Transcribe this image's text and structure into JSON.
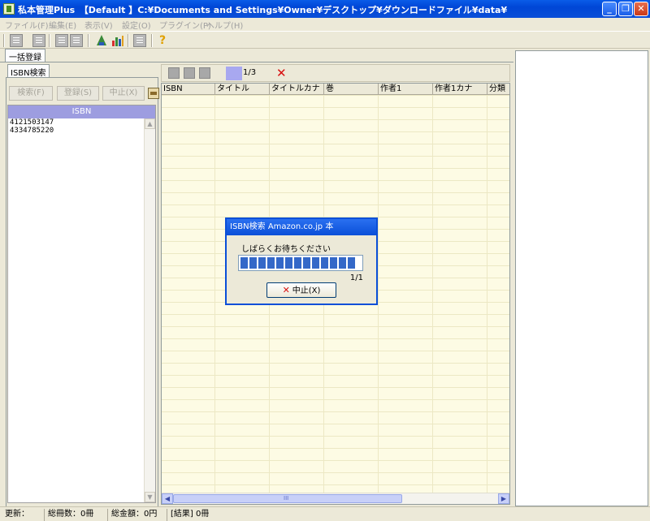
{
  "titlebar": {
    "app_title": "私本管理Plus　【Default 】C:¥Documents and Settings¥Owner¥デスクトップ¥ダウンロードファイル¥data¥",
    "minimize": "_",
    "restore": "❐",
    "close": "✕"
  },
  "menu": {
    "file": "ファイル(F)",
    "edit": "編集(E)",
    "view": "表示(V)",
    "settings": "設定(O)",
    "plugin": "プラグイン(P)",
    "help": "ヘルプ(H)"
  },
  "toolbar": {
    "help_icon": "?"
  },
  "main_tab": {
    "label": "一括登録"
  },
  "left": {
    "tab_label": "ISBN検索",
    "search_button": "検索(F)",
    "register_button": "登録(S)",
    "stop_button": "中止(X)",
    "list_header": "ISBN",
    "isbns": [
      "4121503147",
      "4334785220"
    ]
  },
  "center": {
    "page_indicator": "1/3",
    "page_fill_fraction": 0.333,
    "columns": [
      "ISBN",
      "タイトル",
      "タイトルカナ",
      "巻",
      "作者1",
      "作者1カナ",
      "分類"
    ],
    "scroll_grip": "III"
  },
  "status": {
    "updated": "更新：",
    "total_books": "総冊数：0冊",
    "total_amount": "総金額：0円",
    "result": "[結果] 0冊"
  },
  "dialog": {
    "title": "ISBN検索 Amazon.co.jp 本",
    "message": "しばらくお待ちください",
    "progress_fraction": 1.0,
    "progress_text": "1/1",
    "cancel_button": "中止(X)"
  }
}
